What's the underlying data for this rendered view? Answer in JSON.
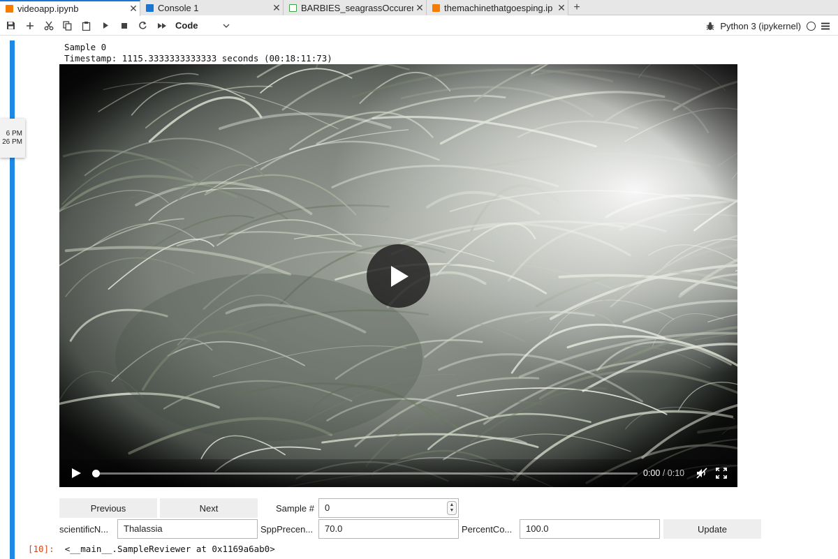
{
  "tabs": [
    {
      "label": "videoapp.ipynb",
      "icon": "notebook-icon",
      "color": "#f57c00",
      "active": true
    },
    {
      "label": "Console 1",
      "icon": "console-icon",
      "color": "#1976d2",
      "active": false
    },
    {
      "label": "BARBIES_seagrassOccurer",
      "icon": "spreadsheet-icon",
      "color": "#43a047",
      "active": false
    },
    {
      "label": "themachinethatgoesping.ip",
      "icon": "notebook-icon",
      "color": "#f57c00",
      "active": false
    }
  ],
  "toolbar": {
    "cell_type": "Code",
    "kernel_name": "Python 3 (ipykernel)"
  },
  "tooltip": {
    "line1": "6 PM",
    "line2": "26 PM"
  },
  "output": {
    "sample_line": "Sample 0",
    "timestamp_line": "Timestamp: 1115.3333333333333 seconds (00:18:11:73)"
  },
  "video": {
    "current_time": "0:00",
    "separator": " / ",
    "duration": "0:10",
    "progress": 0.0
  },
  "widgets": {
    "previous_label": "Previous",
    "next_label": "Next",
    "sample_label": "Sample #",
    "sample_value": "0",
    "scientific_label": "scientificN...",
    "scientific_value": "Thalassia",
    "spp_label": "SppPrecen...",
    "spp_value": "70.0",
    "percent_label": "PercentCo...",
    "percent_value": "100.0",
    "update_label": "Update"
  },
  "result": {
    "prompt": "[10]:",
    "repr": "<__main__.SampleReviewer at 0x1169a6ab0>"
  },
  "colors": {
    "accent": "#1e88e5",
    "prompt": "#d84315"
  }
}
